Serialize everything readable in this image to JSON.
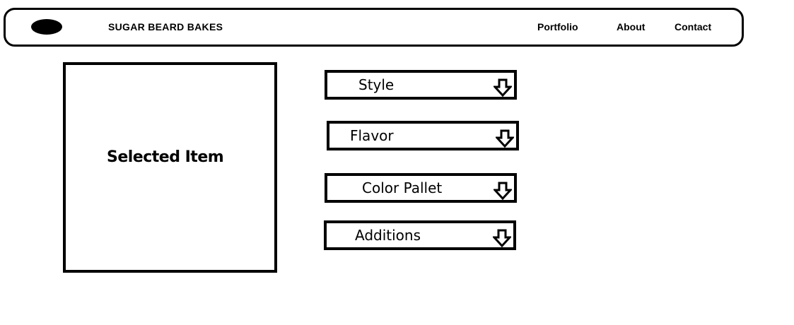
{
  "header": {
    "logo_icon": "black-oval-logo",
    "brand": "SUGAR BEARD BAKES",
    "nav": {
      "portfolio": "Portfolio",
      "about": "About",
      "contact": "Contact"
    }
  },
  "main": {
    "selected_item_label": "Selected Item",
    "dropdowns": {
      "style": "Style",
      "flavor": "Flavor",
      "color_pallet": "Color Pallet",
      "additions": "Additions"
    },
    "dropdown_icon": "down-arrow-outline-icon"
  }
}
